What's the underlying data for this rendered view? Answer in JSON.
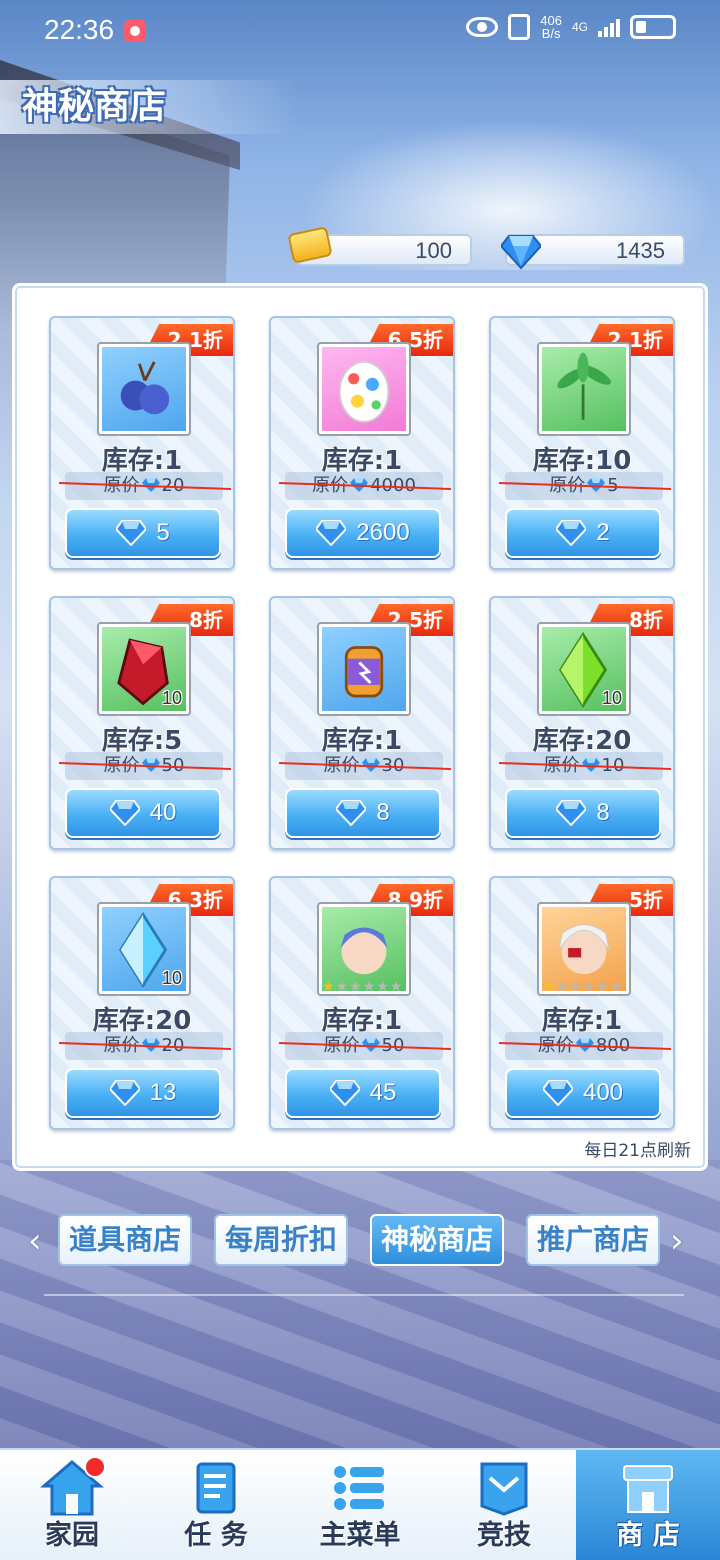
{
  "status_bar": {
    "time": "22:36",
    "speed_value": "406",
    "speed_unit": "B/s",
    "network": "4G"
  },
  "page": {
    "title": "神秘商店"
  },
  "currencies": {
    "tickets": {
      "value": "100",
      "icon": "ticket-icon"
    },
    "gems": {
      "value": "1435",
      "icon": "diamond-icon"
    }
  },
  "items": [
    {
      "name": "plum-fruit",
      "icon": "plum-icon",
      "frame": "blue",
      "discount": "2.1折",
      "stock": "库存:1",
      "orig_label": "原价",
      "orig_price": "20",
      "price": "5"
    },
    {
      "name": "spotted-egg",
      "icon": "egg-icon",
      "frame": "pink",
      "discount": "6.5折",
      "stock": "库存:1",
      "orig_label": "原价",
      "orig_price": "4000",
      "price": "2600"
    },
    {
      "name": "herb-leaf",
      "icon": "leaf-icon",
      "frame": "green",
      "discount": "2.1折",
      "stock": "库存:10",
      "orig_label": "原价",
      "orig_price": "5",
      "price": "2"
    },
    {
      "name": "red-crystal",
      "icon": "red-crystal-icon",
      "frame": "green",
      "qty": "10",
      "discount": "8折",
      "stock": "库存:5",
      "orig_label": "原价",
      "orig_price": "50",
      "price": "40"
    },
    {
      "name": "energy-canister",
      "icon": "canister-icon",
      "frame": "blue",
      "discount": "2.5折",
      "stock": "库存:1",
      "orig_label": "原价",
      "orig_price": "30",
      "price": "8"
    },
    {
      "name": "green-crystal",
      "icon": "green-crystal-icon",
      "frame": "green",
      "qty": "10",
      "discount": "8折",
      "stock": "库存:20",
      "orig_label": "原价",
      "orig_price": "10",
      "price": "8"
    },
    {
      "name": "blue-crystal",
      "icon": "blue-crystal-icon",
      "frame": "blue",
      "qty": "10",
      "discount": "6.3折",
      "stock": "库存:20",
      "orig_label": "原价",
      "orig_price": "20",
      "price": "13"
    },
    {
      "name": "blue-hair-character",
      "icon": "character-portrait-icon",
      "frame": "green",
      "stars": 1,
      "discount": "8.9折",
      "stock": "库存:1",
      "orig_label": "原价",
      "orig_price": "50",
      "price": "45"
    },
    {
      "name": "white-hair-character",
      "icon": "character-portrait-icon",
      "frame": "orange",
      "stars": 1,
      "discount": "5折",
      "stock": "库存:1",
      "orig_label": "原价",
      "orig_price": "800",
      "price": "400"
    }
  ],
  "refresh_note": "每日21点刷新",
  "tabs": [
    {
      "label": "道具商店",
      "active": false
    },
    {
      "label": "每周折扣",
      "active": false
    },
    {
      "label": "神秘商店",
      "active": true
    },
    {
      "label": "推广商店",
      "active": false
    }
  ],
  "nav": [
    {
      "label": "家园",
      "icon": "home-icon",
      "badge": true,
      "active": false
    },
    {
      "label": "任 务",
      "icon": "scroll-icon",
      "badge": false,
      "active": false
    },
    {
      "label": "主菜单",
      "icon": "menu-list-icon",
      "badge": false,
      "active": false
    },
    {
      "label": "竞技",
      "icon": "arena-banner-icon",
      "badge": false,
      "active": false
    },
    {
      "label": "商 店",
      "icon": "shop-icon",
      "badge": false,
      "active": true
    }
  ],
  "colors": {
    "accent": "#2f8fdc",
    "discount": "#e8290e",
    "strike": "#e53020"
  }
}
